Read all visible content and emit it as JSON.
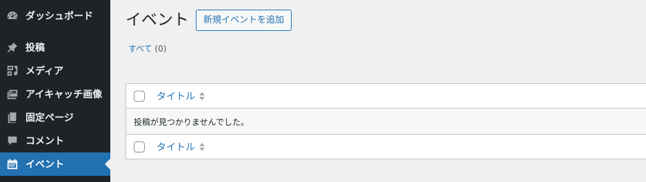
{
  "sidebar": {
    "items": [
      {
        "label": "ダッシュボード",
        "icon": "dashboard-icon"
      },
      {
        "label": "投稿",
        "icon": "pin-icon"
      },
      {
        "label": "メディア",
        "icon": "media-icon"
      },
      {
        "label": "アイキャッチ画像",
        "icon": "images-icon"
      },
      {
        "label": "固定ページ",
        "icon": "page-icon"
      },
      {
        "label": "コメント",
        "icon": "comment-icon"
      },
      {
        "label": "イベント",
        "icon": "calendar-icon",
        "current": true
      }
    ],
    "current_color": "#2271b1",
    "background": "#1d2327"
  },
  "main": {
    "title": "イベント",
    "add_new_label": "新規イベントを追加",
    "filter": {
      "label": "すべて",
      "count": "(0)"
    },
    "table": {
      "column_title": "タイトル",
      "no_items": "投稿が見つかりませんでした。"
    }
  }
}
